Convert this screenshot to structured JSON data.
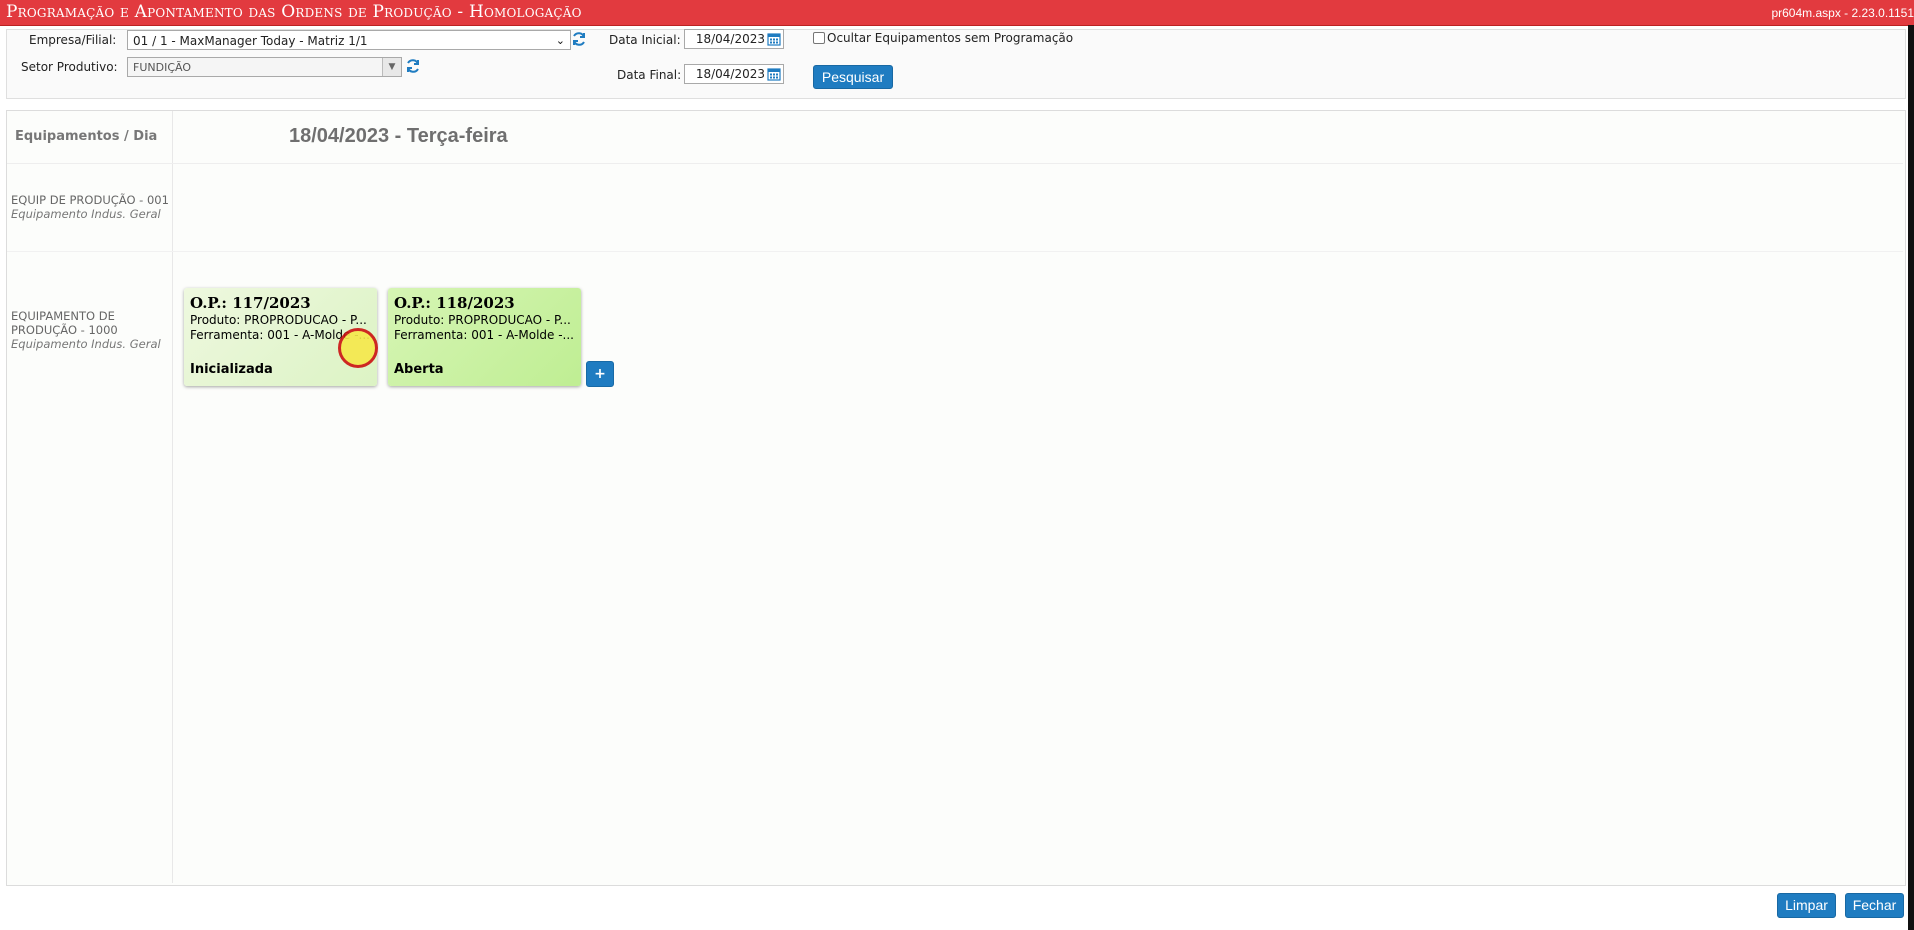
{
  "titlebar": {
    "title": "Programação e Apontamento das Ordens de Produção  - Homologação",
    "version": "pr604m.aspx - 2.23.0.1151"
  },
  "filters": {
    "empresa_label": "Empresa/Filial:",
    "empresa_value": "01 / 1 - MaxManager Today - Matriz 1/1",
    "setor_label": "Setor Produtivo:",
    "setor_value": "FUNDIÇÃO",
    "data_inicial_label": "Data Inicial:",
    "data_inicial_value": "18/04/2023",
    "data_final_label": "Data Final:",
    "data_final_value": "18/04/2023",
    "ocultar_label": "Ocultar Equipamentos sem Programação",
    "pesquisar_label": "Pesquisar"
  },
  "board": {
    "header_left": "Equipamentos / Dia",
    "day_header": "18/04/2023 - Terça-feira",
    "equipments": [
      {
        "name": "EQUIP DE PRODUÇÃO - 001",
        "type": "Equipamento Indus. Geral"
      },
      {
        "name": "EQUIPAMENTO DE PRODUÇÃO - 1000",
        "type": "Equipamento Indus. Geral"
      }
    ],
    "cards": [
      {
        "op": "O.P.: 117/2023",
        "produto": "Produto: PROPRODUCAO - P...",
        "ferramenta": "Ferramenta: 001 - A-Molde -...",
        "status": "Inicializada"
      },
      {
        "op": "O.P.: 118/2023",
        "produto": "Produto: PROPRODUCAO - P...",
        "ferramenta": "Ferramenta: 001 - A-Molde -...",
        "status": "Aberta"
      }
    ],
    "add_label": "+"
  },
  "footer": {
    "limpar_label": "Limpar",
    "fechar_label": "Fechar"
  },
  "colors": {
    "titlebar": "#e23a3f",
    "button": "#1f7cc1",
    "card_started": "#dcf3c4",
    "card_open": "#bfee93"
  },
  "icons": [
    "refresh-icon",
    "calendar-icon",
    "chevron-down-icon"
  ]
}
